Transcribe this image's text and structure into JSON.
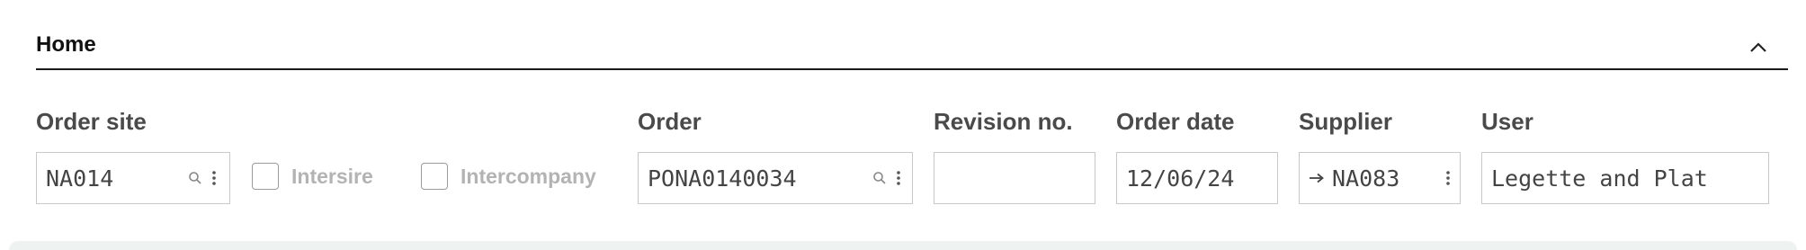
{
  "section": {
    "title": "Home"
  },
  "fields": {
    "order_site": {
      "label": "Order site",
      "value": "NA014"
    },
    "intersite": {
      "label": "Intersire",
      "checked": false
    },
    "intercompany": {
      "label": "Intercompany",
      "checked": false
    },
    "order": {
      "label": "Order",
      "value": "PONA0140034"
    },
    "revision": {
      "label": "Revision no.",
      "value": ""
    },
    "order_date": {
      "label": "Order date",
      "value": "12/06/24"
    },
    "supplier": {
      "label": "Supplier",
      "value": "NA083"
    },
    "user": {
      "label": "User",
      "value": "Legette and Plat"
    }
  },
  "icons": {
    "lookup": "search-icon",
    "options": "more-vertical-icon",
    "link": "arrow-right-icon",
    "collapse": "chevron-up-icon"
  },
  "colors": {
    "accent": "#1a1a1a",
    "label": "#4a4a4a",
    "disabled": "#b3b3b3",
    "border": "#c9c9c9"
  }
}
